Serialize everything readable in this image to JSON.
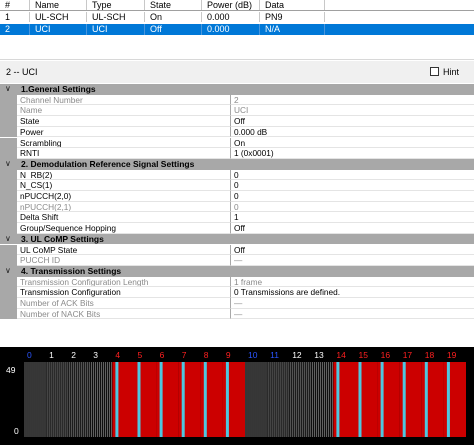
{
  "channel_table": {
    "headers": [
      "#",
      "Name",
      "Type",
      "State",
      "Power (dB)",
      "Data"
    ],
    "rows": [
      [
        "1",
        "UL-SCH",
        "UL-SCH",
        "On",
        "0.000",
        "PN9"
      ],
      [
        "2",
        "UCI",
        "UCI",
        "Off",
        "0.000",
        "N/A"
      ]
    ],
    "selected_row": 1
  },
  "title_bar": {
    "title": "2 -- UCI",
    "hint_label": "Hint",
    "hint_checked": false
  },
  "property_grid": {
    "sections": [
      {
        "title": "1.General Settings",
        "rows": [
          {
            "name": "Channel Number",
            "value": "2",
            "disabled": true
          },
          {
            "name": "Name",
            "value": "UCI",
            "disabled": true
          },
          {
            "name": "State",
            "value": "Off",
            "disabled": false
          },
          {
            "name": "Power",
            "value": "0.000 dB",
            "disabled": false
          },
          {
            "name": "Scrambling",
            "value": "On",
            "disabled": false
          },
          {
            "name": "RNTI",
            "value": "1 (0x0001)",
            "disabled": false
          }
        ]
      },
      {
        "title": "2. Demodulation Reference Signal Settings",
        "rows": [
          {
            "name": "N_RB(2)",
            "value": "0",
            "disabled": false
          },
          {
            "name": "N_CS(1)",
            "value": "0",
            "disabled": false
          },
          {
            "name": "nPUCCH(2,0)",
            "value": "0",
            "disabled": false
          },
          {
            "name": "nPUCCH(2,1)",
            "value": "0",
            "disabled": true
          },
          {
            "name": "Delta Shift",
            "value": "1",
            "disabled": false
          },
          {
            "name": "Group/Sequence Hopping",
            "value": "Off",
            "disabled": false
          }
        ]
      },
      {
        "title": "3. UL CoMP Settings",
        "rows": [
          {
            "name": "UL CoMP State",
            "value": "Off",
            "disabled": false
          },
          {
            "name": "PUCCH ID",
            "value": "—",
            "disabled": true
          }
        ]
      },
      {
        "title": "4. Transmission Settings",
        "rows": [
          {
            "name": "Transmission Configuration Length",
            "value": "1 frame",
            "disabled": true
          },
          {
            "name": "Transmission Configuration",
            "value": "0 Transmissions are defined.",
            "disabled": false
          },
          {
            "name": "Number of ACK Bits",
            "value": "—",
            "disabled": true
          },
          {
            "name": "Number of NACK Bits",
            "value": "—",
            "disabled": true
          }
        ]
      }
    ]
  },
  "graph": {
    "y_top_label": "49",
    "y_bottom_label": "0",
    "slot_labels": [
      "0",
      "1",
      "2",
      "3",
      "4",
      "5",
      "6",
      "7",
      "8",
      "9",
      "10",
      "11",
      "12",
      "13",
      "14",
      "15",
      "16",
      "17",
      "18",
      "19"
    ],
    "slots": [
      {
        "label_color": "blue",
        "kind": "hatch"
      },
      {
        "label_color": "white",
        "kind": "hatch"
      },
      {
        "label_color": "white",
        "kind": "hatch"
      },
      {
        "label_color": "white",
        "kind": "hatch"
      },
      {
        "label_color": "red",
        "kind": "active"
      },
      {
        "label_color": "red",
        "kind": "active"
      },
      {
        "label_color": "red",
        "kind": "active"
      },
      {
        "label_color": "red",
        "kind": "active"
      },
      {
        "label_color": "red",
        "kind": "active"
      },
      {
        "label_color": "red",
        "kind": "active"
      },
      {
        "label_color": "blue",
        "kind": "hatch"
      },
      {
        "label_color": "blue",
        "kind": "hatch"
      },
      {
        "label_color": "white",
        "kind": "hatch"
      },
      {
        "label_color": "white",
        "kind": "hatch"
      },
      {
        "label_color": "red",
        "kind": "active"
      },
      {
        "label_color": "red",
        "kind": "active"
      },
      {
        "label_color": "red",
        "kind": "active"
      },
      {
        "label_color": "red",
        "kind": "active"
      },
      {
        "label_color": "red",
        "kind": "active"
      },
      {
        "label_color": "red",
        "kind": "active"
      }
    ],
    "colors": {
      "active_fill": "#cc0000",
      "active_stripe": "#4ec7e0",
      "hatch": "#8a8a8a",
      "label_red": "#ff2020",
      "label_blue": "#2a55ff",
      "label_white": "#ffffff"
    }
  }
}
